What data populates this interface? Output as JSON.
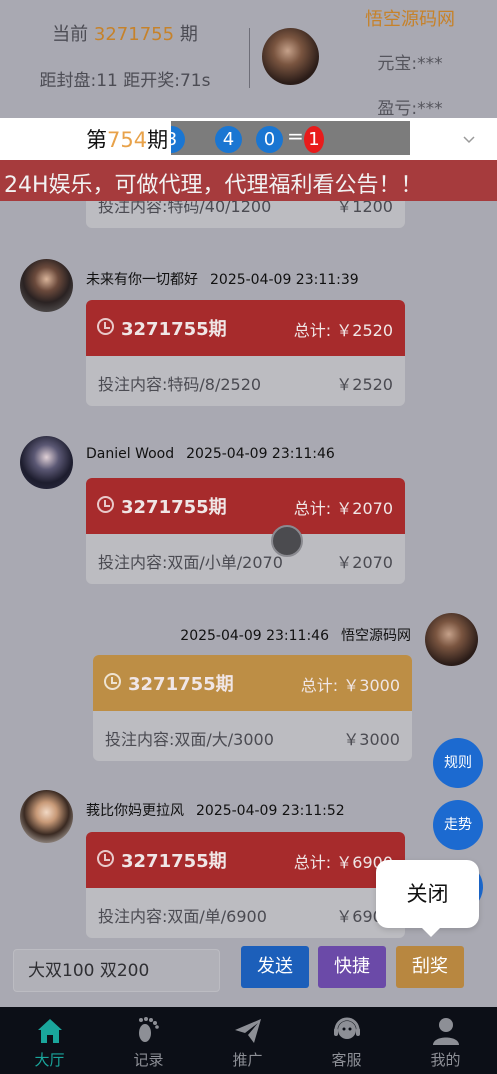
{
  "header": {
    "current_prefix": "当前",
    "current_period": "3271755",
    "current_suffix": "期",
    "countdown": "距封盘:11 距开奖:71s",
    "username": "悟空源码网",
    "yuanbao": "元宝:***",
    "yingkui": "盈亏:***"
  },
  "period_bar": {
    "prefix": "第",
    "period": "754",
    "suffix": "期",
    "balls": [
      "3",
      "4",
      "0"
    ],
    "equals": "=",
    "result": "1"
  },
  "notice": "24H娱乐，可做代理，代理福利看公告！！",
  "messages": [
    {
      "user": "未来有你一切都好",
      "time": "2025-04-09 23:11:39",
      "period": "3271755期",
      "total": "总计: ￥2520",
      "content": "投注内容:特码/8/2520",
      "amount": "￥2520"
    },
    {
      "user": "Daniel Wood",
      "time": "2025-04-09 23:11:46",
      "period": "3271755期",
      "total": "总计: ￥2070",
      "content": "投注内容:双面/小单/2070",
      "amount": "￥2070"
    },
    {
      "user": "悟空源码网",
      "time": "2025-04-09 23:11:46",
      "period": "3271755期",
      "total": "总计: ￥3000",
      "content": "投注内容:双面/大/3000",
      "amount": "￥3000"
    },
    {
      "user": "莪比你妈更拉风",
      "time": "2025-04-09 23:11:52",
      "period": "3271755期",
      "total": "总计: ￥6900",
      "content": "投注内容:双面/单/6900",
      "amount": "￥6900"
    }
  ],
  "partial_top": {
    "content": "投注内容:特码/40/1200",
    "amount": "￥1200"
  },
  "float_buttons": {
    "rules": "规则",
    "trend": "走势"
  },
  "close_popup": "关闭",
  "input": {
    "placeholder": "大双100 双200"
  },
  "actions": {
    "send": "发送",
    "quick": "快捷",
    "scratch": "刮奖"
  },
  "nav": [
    {
      "label": "大厅",
      "icon": "home-icon"
    },
    {
      "label": "记录",
      "icon": "footprint-icon"
    },
    {
      "label": "推广",
      "icon": "paper-plane-icon"
    },
    {
      "label": "客服",
      "icon": "headset-icon"
    },
    {
      "label": "我的",
      "icon": "user-icon"
    }
  ],
  "colors": {
    "accent_gold": "#c6822a",
    "card_red": "#a72b2c",
    "card_gold": "#bd8e45",
    "nav_active": "#1aa69c",
    "notice_bg": "#a63b3d"
  }
}
